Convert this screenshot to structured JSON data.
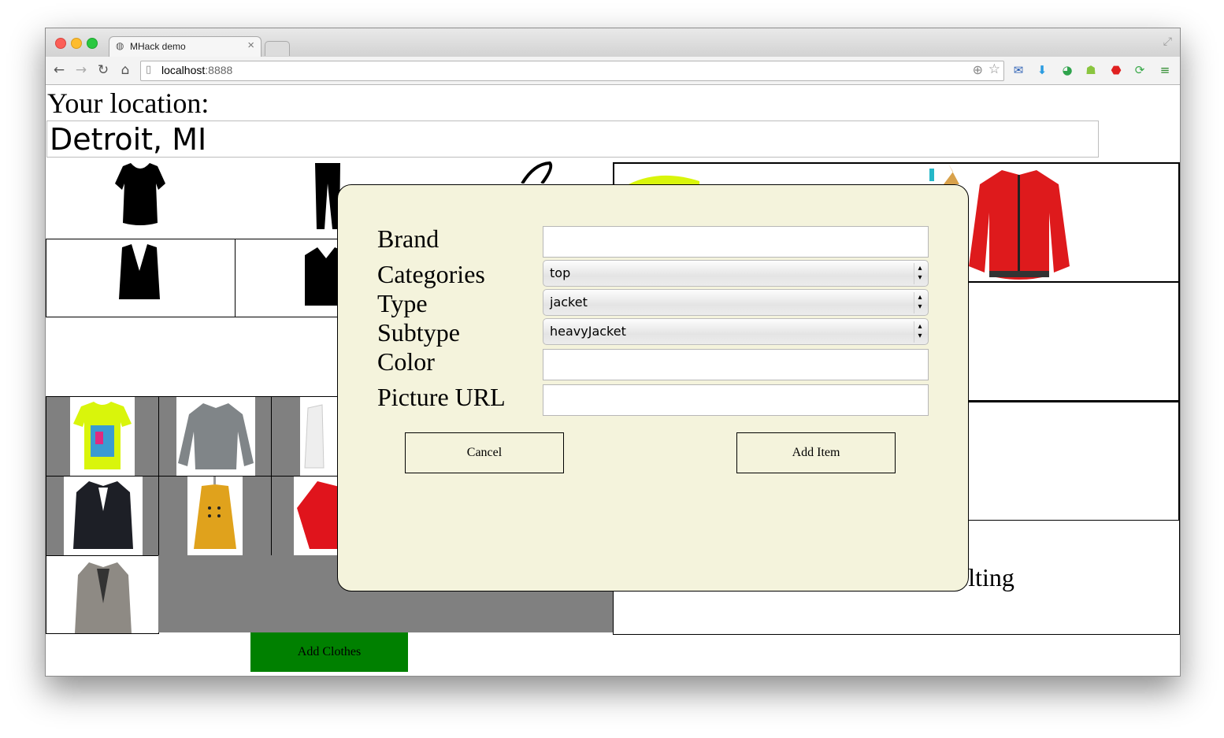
{
  "browser": {
    "tab_title": "MHack demo",
    "tab_close": "×",
    "url_host": "localhost",
    "url_port": ":8888",
    "nav": {
      "back": "←",
      "forward": "→",
      "reload": "↻",
      "home": "⌂"
    },
    "toolbar_icons": [
      "location-icon",
      "star-icon",
      "mail-icon",
      "download-icon",
      "chrome-ext-icon",
      "android-icon",
      "stop-icon",
      "sync-icon",
      "menu-icon"
    ],
    "colors": {
      "close": "#fc5f57",
      "minimize": "#fdbc2e",
      "zoom": "#2ac840"
    }
  },
  "page": {
    "location_label": "Your location:",
    "location_value": "Detroit, MI",
    "add_clothes_label": "Add Clothes",
    "partial_text": "elting",
    "add_clothes_color": "#008000"
  },
  "modal": {
    "fields": {
      "brand_label": "Brand",
      "categories_label": "Categories",
      "type_label": "Type",
      "subtype_label": "Subtype",
      "color_label": "Color",
      "picture_url_label": "Picture URL"
    },
    "values": {
      "brand": "",
      "category": "top",
      "type": "jacket",
      "subtype": "heavyJacket",
      "color": "",
      "picture_url": ""
    },
    "cancel_label": "Cancel",
    "add_item_label": "Add Item",
    "background": "#f4f3dc"
  }
}
